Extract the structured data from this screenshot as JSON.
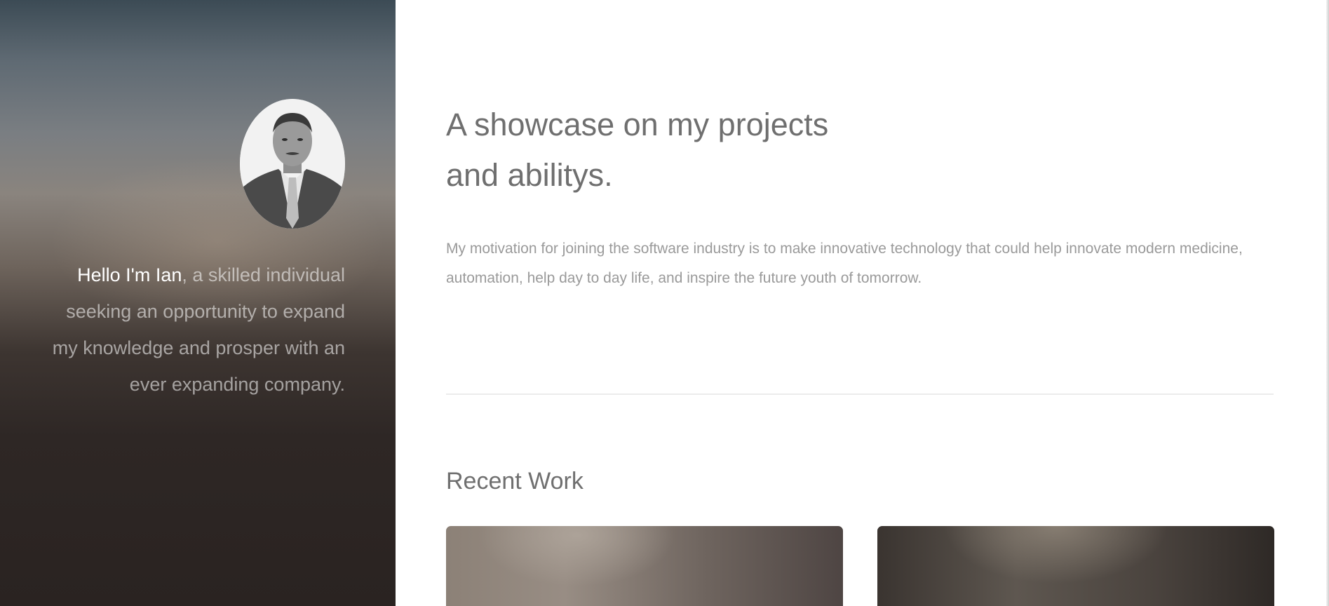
{
  "sidebar": {
    "avatar_alt": "Portrait of Ian",
    "intro_highlight": "Hello I'm Ian",
    "intro_rest": ", a skilled individual seeking an opportunity to expand my knowledge and prosper with an ever expanding company."
  },
  "main": {
    "headline_line1": "A showcase on my projects",
    "headline_line2": "and abilitys.",
    "motivation": "My motivation for joining the software industry is to make innovative technology that could help innovate modern medicine, automation, help day to day life, and inspire the future youth of tomorrow.",
    "recent_work": {
      "title": "Recent Work",
      "items": [
        {
          "thumbnail": "project-thumbnail-1"
        },
        {
          "thumbnail": "project-thumbnail-2"
        }
      ]
    }
  },
  "colors": {
    "headline": "#6f6f6f",
    "body_text": "#9a9a9a",
    "sidebar_highlight": "#ffffff",
    "divider": "#ececec"
  }
}
